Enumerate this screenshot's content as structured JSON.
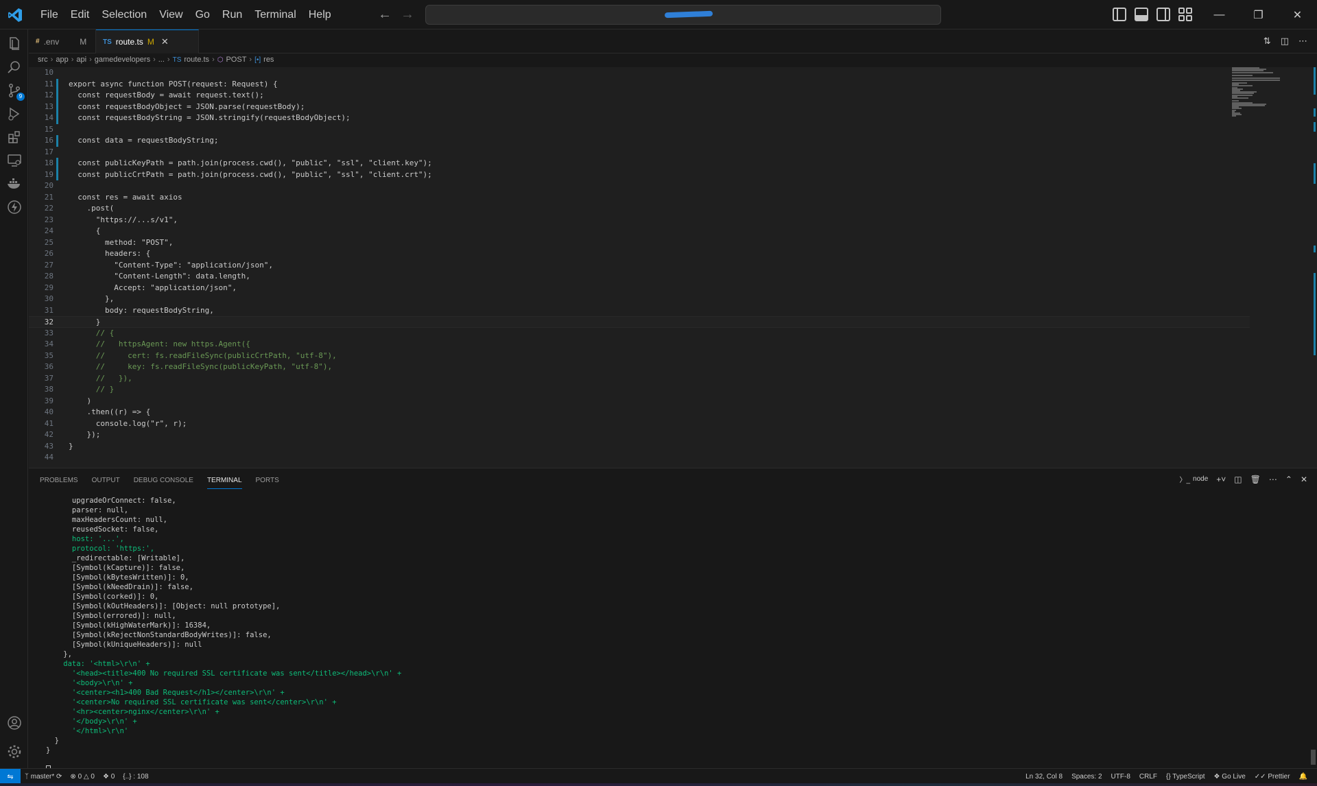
{
  "menu": [
    "File",
    "Edit",
    "Selection",
    "View",
    "Go",
    "Run",
    "Terminal",
    "Help"
  ],
  "command_center": {
    "text": ""
  },
  "tabs": [
    {
      "icon": "#",
      "label": ".env",
      "status": "M",
      "active": false
    },
    {
      "icon": "TS",
      "label": "route.ts",
      "status": "M",
      "active": true
    }
  ],
  "breadcrumb": [
    "src",
    "app",
    "api",
    "gamedevelopers",
    "...",
    "route.ts",
    "POST",
    "res"
  ],
  "editor": {
    "lines": [
      {
        "n": "10",
        "code": "",
        "gutter": ""
      },
      {
        "n": "11",
        "code": "export async function POST(request: Request) {",
        "gutter": "mod"
      },
      {
        "n": "12",
        "code": "  const requestBody = await request.text();",
        "gutter": "mod"
      },
      {
        "n": "13",
        "code": "  const requestBodyObject = JSON.parse(requestBody);",
        "gutter": "mod"
      },
      {
        "n": "14",
        "code": "  const requestBodyString = JSON.stringify(requestBodyObject);",
        "gutter": "mod"
      },
      {
        "n": "15",
        "code": "",
        "gutter": ""
      },
      {
        "n": "16",
        "code": "  const data = requestBodyString;",
        "gutter": "mod"
      },
      {
        "n": "17",
        "code": "",
        "gutter": ""
      },
      {
        "n": "18",
        "code": "  const publicKeyPath = path.join(process.cwd(), \"public\", \"ssl\", \"client.key\");",
        "gutter": "mod"
      },
      {
        "n": "19",
        "code": "  const publicCrtPath = path.join(process.cwd(), \"public\", \"ssl\", \"client.crt\");",
        "gutter": "mod"
      },
      {
        "n": "20",
        "code": "",
        "gutter": ""
      },
      {
        "n": "21",
        "code": "  const res = await axios",
        "gutter": ""
      },
      {
        "n": "22",
        "code": "    .post(",
        "gutter": ""
      },
      {
        "n": "23",
        "code": "      \"https://...s/v1\",",
        "gutter": ""
      },
      {
        "n": "24",
        "code": "      {",
        "gutter": ""
      },
      {
        "n": "25",
        "code": "        method: \"POST\",",
        "gutter": ""
      },
      {
        "n": "26",
        "code": "        headers: {",
        "gutter": ""
      },
      {
        "n": "27",
        "code": "          \"Content-Type\": \"application/json\",",
        "gutter": ""
      },
      {
        "n": "28",
        "code": "          \"Content-Length\": data.length,",
        "gutter": ""
      },
      {
        "n": "29",
        "code": "          Accept: \"application/json\",",
        "gutter": ""
      },
      {
        "n": "30",
        "code": "        },",
        "gutter": ""
      },
      {
        "n": "31",
        "code": "        body: requestBodyString,",
        "gutter": ""
      },
      {
        "n": "32",
        "code": "      }",
        "gutter": "",
        "active": true
      },
      {
        "n": "33",
        "code": "      // {",
        "gutter": ""
      },
      {
        "n": "34",
        "code": "      //   httpsAgent: new https.Agent({",
        "gutter": ""
      },
      {
        "n": "35",
        "code": "      //     cert: fs.readFileSync(publicCrtPath, \"utf-8\"),",
        "gutter": ""
      },
      {
        "n": "36",
        "code": "      //     key: fs.readFileSync(publicKeyPath, \"utf-8\"),",
        "gutter": ""
      },
      {
        "n": "37",
        "code": "      //   }),",
        "gutter": ""
      },
      {
        "n": "38",
        "code": "      // }",
        "gutter": ""
      },
      {
        "n": "39",
        "code": "    )",
        "gutter": ""
      },
      {
        "n": "40",
        "code": "    .then((r) => {",
        "gutter": ""
      },
      {
        "n": "41",
        "code": "      console.log(\"r\", r);",
        "gutter": ""
      },
      {
        "n": "42",
        "code": "    });",
        "gutter": ""
      },
      {
        "n": "43",
        "code": "}",
        "gutter": ""
      },
      {
        "n": "44",
        "code": "",
        "gutter": ""
      }
    ]
  },
  "panel": {
    "tabs": [
      "PROBLEMS",
      "OUTPUT",
      "DEBUG CONSOLE",
      "TERMINAL",
      "PORTS"
    ],
    "active_tab": "TERMINAL",
    "terminal_name": "node",
    "terminal_lines": [
      "      upgradeOrConnect: false,",
      "      parser: null,",
      "      maxHeadersCount: null,",
      "      reusedSocket: false,",
      "      host: '...',",
      "      protocol: 'https:',",
      "      _redirectable: [Writable],",
      "      [Symbol(kCapture)]: false,",
      "      [Symbol(kBytesWritten)]: 0,",
      "      [Symbol(kNeedDrain)]: false,",
      "      [Symbol(corked)]: 0,",
      "      [Symbol(kOutHeaders)]: [Object: null prototype],",
      "      [Symbol(errored)]: null,",
      "      [Symbol(kHighWaterMark)]: 16384,",
      "      [Symbol(kRejectNonStandardBodyWrites)]: false,",
      "      [Symbol(kUniqueHeaders)]: null",
      "    },",
      "    data: '<html>\\r\\n' +",
      "      '<head><title>400 No required SSL certificate was sent</title></head>\\r\\n' +",
      "      '<body>\\r\\n' +",
      "      '<center><h1>400 Bad Request</h1></center>\\r\\n' +",
      "      '<center>No required SSL certificate was sent</center>\\r\\n' +",
      "      '<hr><center>nginx</center>\\r\\n' +",
      "      '</body>\\r\\n' +",
      "      '</html>\\r\\n'",
      "  }",
      "}",
      ""
    ]
  },
  "statusbar": {
    "branch": "master*",
    "errors": "0",
    "warnings": "0",
    "ports": "0",
    "braces": "{..} : 108",
    "position": "Ln 32, Col 8",
    "spaces": "Spaces: 2",
    "encoding": "UTF-8",
    "eol": "CRLF",
    "language": "TypeScript",
    "golive": "Go Live",
    "prettier": "Prettier"
  },
  "colors": {
    "accent": "#0078d4",
    "editor_bg": "#1f1f1f",
    "chrome_bg": "#181818",
    "gutter_modified": "#1b81a8"
  }
}
